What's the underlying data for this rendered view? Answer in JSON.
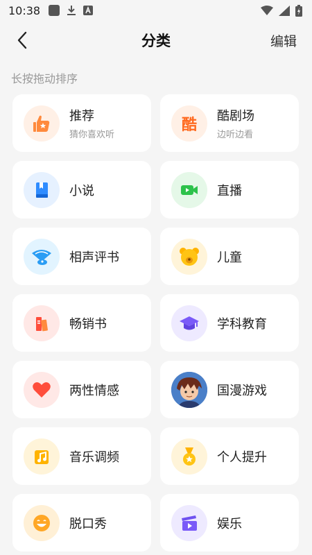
{
  "status_bar": {
    "time": "10:38"
  },
  "header": {
    "title": "分类",
    "edit_label": "编辑"
  },
  "hint": "长按拖动排序",
  "categories": [
    {
      "label": "推荐",
      "subtitle": "猜你喜欢听",
      "icon": "thumbs-up-star-icon"
    },
    {
      "label": "酷剧场",
      "subtitle": "边听边看",
      "icon": "ku-theater-icon",
      "icon_text": "酷"
    },
    {
      "label": "小说",
      "icon": "book-icon"
    },
    {
      "label": "直播",
      "icon": "live-camera-icon"
    },
    {
      "label": "相声评书",
      "icon": "fan-icon"
    },
    {
      "label": "儿童",
      "icon": "bear-face-icon"
    },
    {
      "label": "畅销书",
      "icon": "bestseller-books-icon"
    },
    {
      "label": "学科教育",
      "icon": "graduation-cap-icon"
    },
    {
      "label": "两性情感",
      "icon": "heart-icon"
    },
    {
      "label": "国漫游戏",
      "icon": "anime-avatar-icon"
    },
    {
      "label": "音乐调频",
      "icon": "music-note-icon"
    },
    {
      "label": "个人提升",
      "icon": "medal-icon"
    },
    {
      "label": "脱口秀",
      "icon": "laughing-face-icon"
    },
    {
      "label": "娱乐",
      "icon": "clapperboard-icon"
    }
  ]
}
